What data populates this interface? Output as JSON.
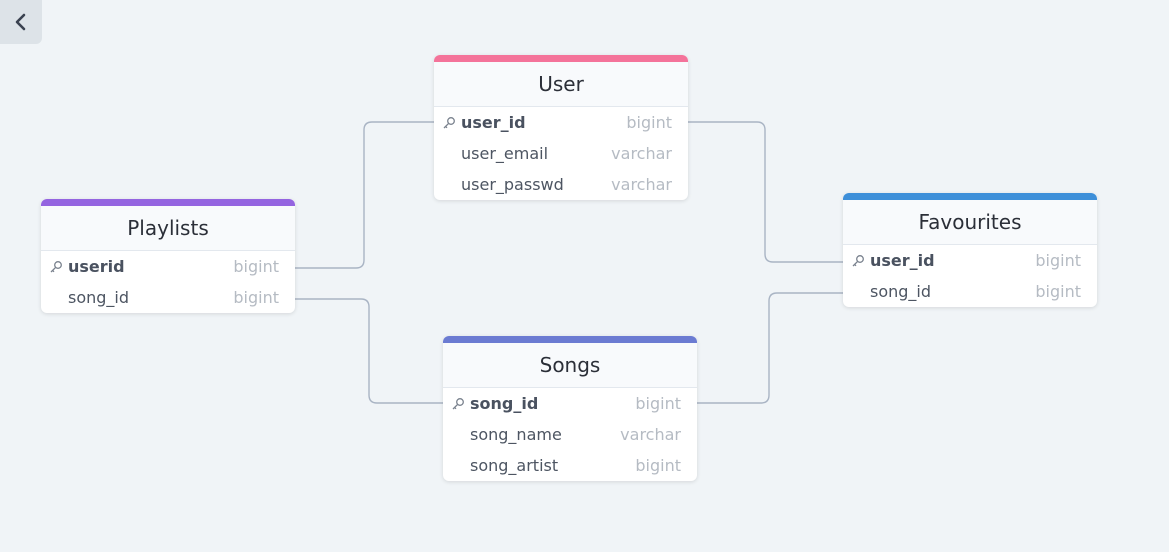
{
  "colors": {
    "user": "#f4739a",
    "playlists": "#9464e0",
    "favourites": "#3d8fd9",
    "songs": "#6b7bd2",
    "connector": "#a9b4c4"
  },
  "nav": {
    "back_icon": "chevron-left-icon"
  },
  "tables": {
    "user": {
      "name": "User",
      "columns": [
        {
          "name": "user_id",
          "type": "bigint",
          "pk": true
        },
        {
          "name": "user_email",
          "type": "varchar",
          "pk": false
        },
        {
          "name": "user_passwd",
          "type": "varchar",
          "pk": false
        }
      ]
    },
    "playlists": {
      "name": "Playlists",
      "columns": [
        {
          "name": "userid",
          "type": "bigint",
          "pk": true
        },
        {
          "name": "song_id",
          "type": "bigint",
          "pk": false
        }
      ]
    },
    "favourites": {
      "name": "Favourites",
      "columns": [
        {
          "name": "user_id",
          "type": "bigint",
          "pk": true
        },
        {
          "name": "song_id",
          "type": "bigint",
          "pk": false
        }
      ]
    },
    "songs": {
      "name": "Songs",
      "columns": [
        {
          "name": "song_id",
          "type": "bigint",
          "pk": true
        },
        {
          "name": "song_name",
          "type": "varchar",
          "pk": false
        },
        {
          "name": "song_artist",
          "type": "bigint",
          "pk": false
        }
      ]
    }
  },
  "relations": [
    {
      "from": "playlists.userid",
      "to": "user.user_id"
    },
    {
      "from": "user.user_id",
      "to": "favourites.user_id"
    },
    {
      "from": "playlists.song_id",
      "to": "songs.song_id"
    },
    {
      "from": "songs.song_id",
      "to": "favourites.song_id"
    }
  ]
}
